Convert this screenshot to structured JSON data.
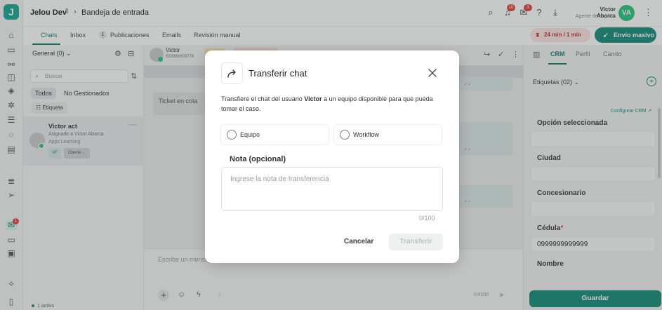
{
  "app": {
    "logo_letter": "J",
    "workspace": "Jelou Dev",
    "breadcrumb": "Bandeja de entrada"
  },
  "topbar": {
    "notifications_badge": "10",
    "mail_badge": "3",
    "user_name": "Victor Abarca",
    "user_role": "Agente de soporte",
    "avatar_initials": "VA"
  },
  "tabs": {
    "chats": "Chats",
    "inbox": "Inbox",
    "publicaciones_count": "1",
    "publicaciones": "Publicaciones",
    "emails": "Emails",
    "revision": "Revisión manual",
    "timer": "24 min / 1 min",
    "envio_masivo": "Envío masivo"
  },
  "list": {
    "filter": "General (0)",
    "search_placeholder": "Buscar",
    "chip_todos": "Todos",
    "chip_no_gestionados": "No Gestionados",
    "etiqueta": "Etiqueta",
    "conversation": {
      "name": "Victor act",
      "assigned": "Asignado a Victor Abarca",
      "channel": "Apps Learning",
      "tag_initials": "VF",
      "tag_label": "Cliente ..."
    },
    "active_count": "1 activo"
  },
  "chat": {
    "contact_name": "Victor",
    "contact_phone": "593986909778",
    "system_message": "Ticket en cola",
    "composer_placeholder": "Escribe un mensaje",
    "char_counter": "0/4000"
  },
  "crm": {
    "tab_crm": "CRM",
    "tab_perfil": "Perfil",
    "tab_camto": "Camto",
    "etiquetas": "Etiquetas (02)",
    "configurar": "Configurar CRM",
    "fields": [
      {
        "label": "Opción seleccionada",
        "value": "",
        "required": false
      },
      {
        "label": "Ciudad",
        "value": "",
        "required": false
      },
      {
        "label": "Concesionario",
        "value": "",
        "required": false
      },
      {
        "label": "Cédula",
        "value": "0999999999999",
        "required": true
      },
      {
        "label": "Nombre",
        "value": "",
        "required": false
      }
    ],
    "save": "Guardar"
  },
  "modal": {
    "title": "Transferir chat",
    "desc_before": "Transfiere el chat del usuario ",
    "desc_user": "Victor",
    "desc_after": " a un equipo disponible para que pueda tomar el caso.",
    "option_equipo": "Equipo",
    "option_workflow": "Workflow",
    "note_label": "Nota (opcional)",
    "note_placeholder": "Ingrese la nota de transferencia",
    "counter": "0/100",
    "cancel": "Cancelar",
    "transfer": "Transferir"
  }
}
